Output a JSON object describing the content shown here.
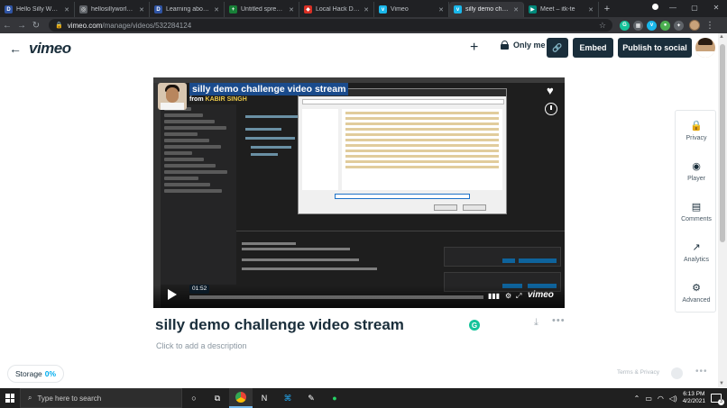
{
  "browser": {
    "tabs": [
      {
        "title": "Hello Silly World! -",
        "fav": "D",
        "color": "#2f54a4",
        "active": false
      },
      {
        "title": "hellosillyworld - B",
        "fav": "◎",
        "color": "#5f6368",
        "active": false
      },
      {
        "title": "Learning about L",
        "fav": "D",
        "color": "#2f54a4",
        "active": false
      },
      {
        "title": "Untitled spreadsh",
        "fav": "+",
        "color": "#188038",
        "active": false
      },
      {
        "title": "Local Hack Day: S",
        "fav": "◆",
        "color": "#d93025",
        "active": false
      },
      {
        "title": "Vimeo",
        "fav": "v",
        "color": "#1ab7ea",
        "active": false
      },
      {
        "title": "silly demo challe",
        "fav": "v",
        "color": "#1ab7ea",
        "active": true
      },
      {
        "title": "Meet – itk-te",
        "fav": "▶",
        "color": "#00897b",
        "active": false
      }
    ],
    "new_tab": "+",
    "url_host": "vimeo.com",
    "url_path": "/manage/videos/532284124"
  },
  "header": {
    "logo": "vimeo",
    "privacy_label": "Only me",
    "embed_label": "Embed",
    "publish_label": "Publish to social"
  },
  "video": {
    "overlay_title": "silly demo challenge video stream",
    "overlay_from": "from",
    "overlay_author": "KABIR SINGH",
    "time": "01:52",
    "progress": 0.0,
    "brand": "vimeo"
  },
  "side_panel": [
    {
      "label": "Privacy",
      "icon": "lock-icon",
      "glyph": "🔒"
    },
    {
      "label": "Player",
      "icon": "palette-icon",
      "glyph": "◉"
    },
    {
      "label": "Comments",
      "icon": "comment-icon",
      "glyph": "▤"
    },
    {
      "label": "Analytics",
      "icon": "analytics-icon",
      "glyph": "↗"
    },
    {
      "label": "Advanced",
      "icon": "gear-icon",
      "glyph": "⚙"
    }
  ],
  "details": {
    "title": "silly demo challenge video stream",
    "description_placeholder": "Click to add a description"
  },
  "footer": {
    "storage_label": "Storage",
    "storage_value": "0%",
    "terms": "Terms & Privacy"
  },
  "taskbar": {
    "search_placeholder": "Type here to search",
    "time": "6:13 PM",
    "date": "4/2/2021",
    "notifications": "3"
  },
  "colors": {
    "brand_dark": "#1a2e3b",
    "accent": "#00adef"
  }
}
